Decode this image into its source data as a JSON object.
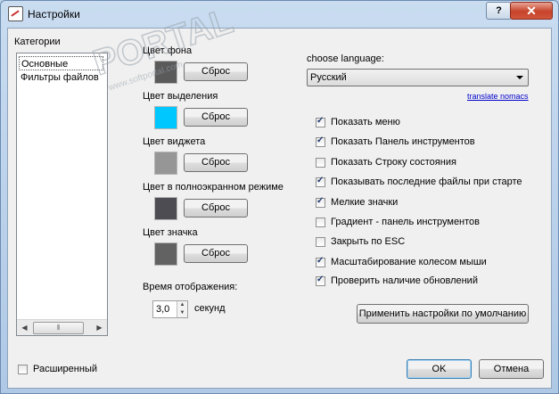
{
  "window": {
    "title": "Настройки",
    "help_label": "?",
    "close_label": "✕"
  },
  "categories": {
    "heading": "Категории",
    "items": [
      "Основные",
      "Фильтры файлов"
    ]
  },
  "colors": {
    "items": [
      {
        "label": "Цвет фона",
        "swatch": "#5a5a5a",
        "reset": "Сброс"
      },
      {
        "label": "Цвет выделения",
        "swatch": "#00c8ff",
        "reset": "Сброс"
      },
      {
        "label": "Цвет виджета",
        "swatch": "#969696",
        "reset": "Сброс"
      },
      {
        "label": "Цвет в полноэкранном режиме",
        "swatch": "#4c4c52",
        "reset": "Сброс"
      },
      {
        "label": "Цвет значка",
        "swatch": "#626262",
        "reset": "Сброс"
      }
    ]
  },
  "display_time": {
    "label": "Время отображения:",
    "value": "3,0",
    "unit": "секунд"
  },
  "language": {
    "label": "choose language:",
    "selected": "Русский",
    "translate_link": "translate nomacs"
  },
  "options": [
    {
      "label": "Показать меню",
      "checked": true
    },
    {
      "label": "Показать Панель инструментов",
      "checked": true
    },
    {
      "label": "Показать Строку состояния",
      "checked": false
    },
    {
      "label": "Показывать последние файлы при старте",
      "checked": true
    },
    {
      "label": "Мелкие значки",
      "checked": true
    },
    {
      "label": "Градиент - панель инструментов",
      "checked": false
    },
    {
      "label": "Закрыть по ESC",
      "checked": false
    },
    {
      "label": "Масштабирование колесом мыши",
      "checked": true
    },
    {
      "label": "Проверить наличие обновлений",
      "checked": true
    }
  ],
  "defaults_button": "Применить настройки по умолчанию",
  "advanced": {
    "label": "Расширенный",
    "checked": false
  },
  "buttons": {
    "ok": "OK",
    "cancel": "Отмена"
  },
  "watermark": {
    "text": "PORTAL",
    "sub": "www.softportal.com"
  }
}
